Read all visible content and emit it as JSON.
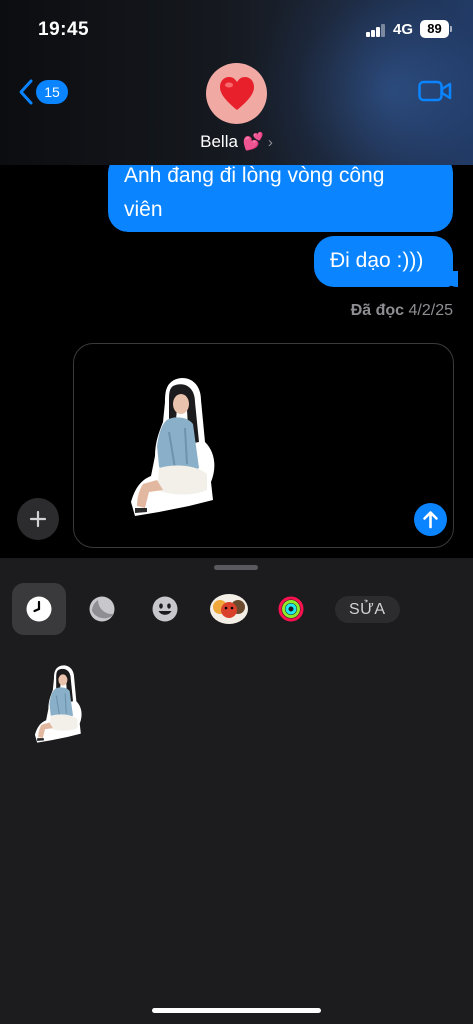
{
  "status_bar": {
    "time": "19:45",
    "network": "4G",
    "battery": "89"
  },
  "header": {
    "back_count": "15",
    "contact_name": "Bella 💕",
    "avatar_icon": "heart-icon",
    "video_icon": "video-camera-icon"
  },
  "messages": [
    {
      "text_line1": "Anh đang đi lòng vòng công",
      "text_line2": "viên",
      "from": "me"
    },
    {
      "text": "Đi dạo :)))",
      "from": "me"
    }
  ],
  "read_receipt": {
    "label": "Đã đọc",
    "date": "4/2/25"
  },
  "compose": {
    "attachment": "sticker",
    "send_icon": "arrow-up-icon",
    "plus_icon": "plus-icon"
  },
  "drawer": {
    "tabs": [
      {
        "name": "recent",
        "icon": "clock-icon",
        "selected": true
      },
      {
        "name": "moon",
        "icon": "moon-icon"
      },
      {
        "name": "emoji",
        "icon": "smiley-icon"
      },
      {
        "name": "memoji",
        "icon": "memoji-icon"
      },
      {
        "name": "fitness",
        "icon": "activity-rings-icon"
      }
    ],
    "edit_label": "SỬA"
  },
  "colors": {
    "accent": "#0a84ff",
    "background": "#000000",
    "drawer": "#1c1c1e",
    "avatar_bg": "#f0a9a3"
  }
}
